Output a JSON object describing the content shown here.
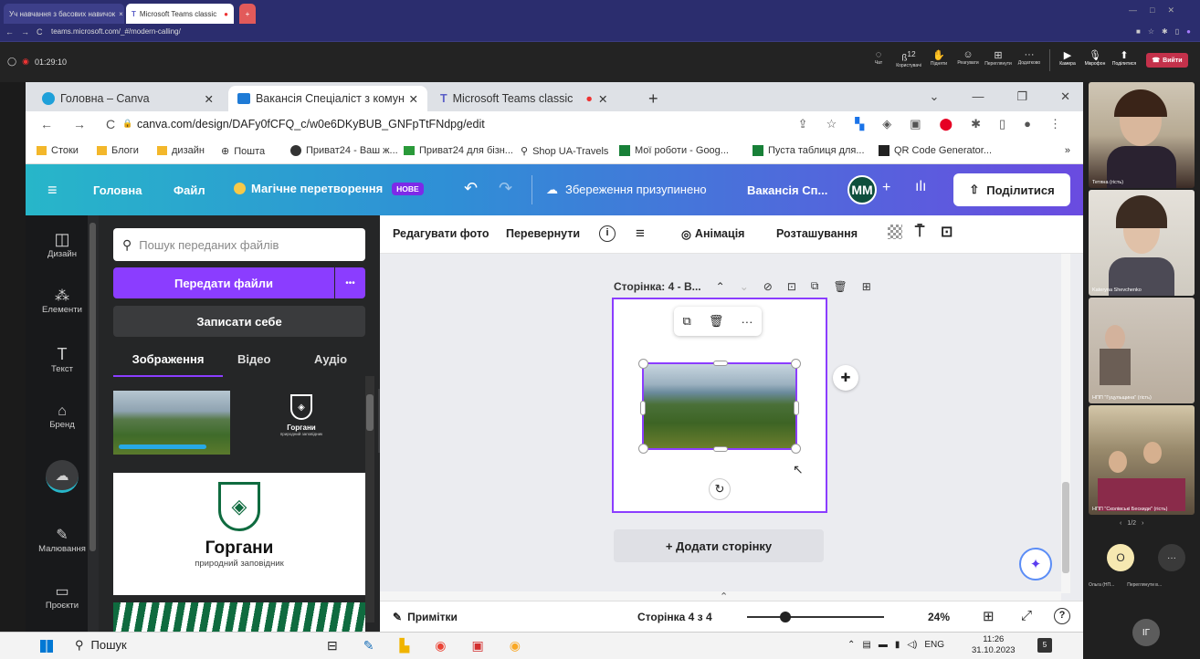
{
  "outer_browser": {
    "tabs": [
      "Уч навчання з басових навичок",
      "Microsoft Teams classic",
      "●"
    ],
    "url": "teams.microsoft.com/_#/modern-calling/"
  },
  "teams": {
    "timer": "01:29:10",
    "controls": [
      "Чат",
      "Користувачі",
      "Підняти",
      "Реагувати",
      "Переглянути",
      "Додатково",
      "Камера",
      "Мікрофон",
      "Поділитися"
    ],
    "participants_count": "12",
    "leave_label": "Вийти"
  },
  "browser": {
    "tabs": [
      {
        "label": "Головна – Canva",
        "icon": "canva-icon"
      },
      {
        "label": "Вакансія Спеціаліст з комунікац",
        "icon": "canva-doc-icon"
      },
      {
        "label": "Microsoft Teams classic",
        "icon": "teams-icon"
      }
    ],
    "url": "canva.com/design/DAFy0fCFQ_c/w0e6DKyBUB_GNFpTtFNdpg/edit",
    "bookmarks": [
      "Стоки",
      "Блоги",
      "дизайн",
      "Пошта",
      "Приват24 - Ваш ж...",
      "Приват24 для бізн...",
      "Shop UA-Travels",
      "Мої роботи - Goog...",
      "Пуста таблиця для...",
      "QR Code Generator..."
    ],
    "bookmarks_more": "»"
  },
  "canva": {
    "header": {
      "home": "Головна",
      "file": "Файл",
      "magic": "Магічне перетворення",
      "new_badge": "НОВЕ",
      "save_status": "Збереження призупинено",
      "doc_title": "Вакансія Сп...",
      "avatar": "MM",
      "share": "Поділитися"
    },
    "rail": [
      "Дизайн",
      "Елементи",
      "Текст",
      "Бренд",
      "",
      "Малювання",
      "Проєкти"
    ],
    "panel": {
      "search_placeholder": "Пошук переданих файлів",
      "upload": "Передати файли",
      "more": "•••",
      "record": "Записати себе",
      "tabs": [
        "Зображення",
        "Відео",
        "Аудіо"
      ],
      "logo_small_name": "Горгани",
      "logo_small_sub": "природний заповідник",
      "logo_big_name": "Горгани",
      "logo_big_sub": "природний заповідник"
    },
    "toolbar": {
      "edit_photo": "Редагувати фото",
      "flip": "Перевернути",
      "animation": "Анімація",
      "position": "Розташування"
    },
    "page": {
      "label": "Сторінка: 4 - В...",
      "add_page": "+ Додати сторінку"
    },
    "footer": {
      "notes": "Примітки",
      "page_count": "Сторінка 4 з 4",
      "zoom": "24%",
      "zoom_fraction": 0.28,
      "help": "?"
    }
  },
  "taskbar": {
    "search": "Пошук",
    "lang": "ENG",
    "time": "11:26",
    "date": "31.10.2023",
    "notif_count": "5"
  },
  "video_column": {
    "participants": [
      "Тетяна (гість)",
      "Kateryna Shevchenko",
      "НПП \"Гуцульщина\" (гість)",
      "НПП \"Сколівські Бескиди\" (гість)"
    ],
    "pager": "1/2",
    "bottom_avatar": "О",
    "bottom_labels": [
      "Ольга (НП...",
      "Переглянути в..."
    ],
    "avatar_initials": "ІГ"
  }
}
